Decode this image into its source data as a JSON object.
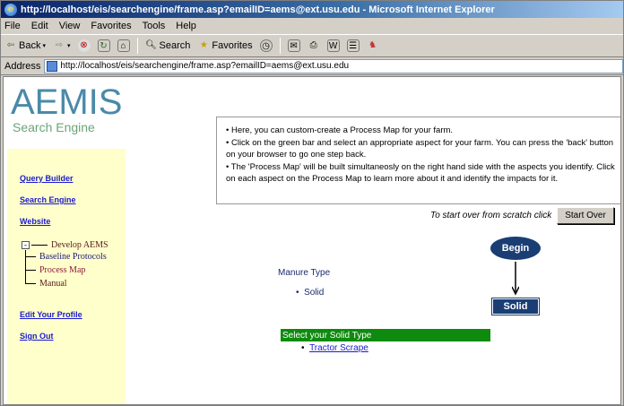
{
  "window": {
    "title": "http://localhost/eis/searchengine/frame.asp?emailID=aems@ext.usu.edu - Microsoft Internet Explorer"
  },
  "menubar": [
    "File",
    "Edit",
    "View",
    "Favorites",
    "Tools",
    "Help"
  ],
  "toolbar": {
    "back": "Back",
    "search": "Search",
    "favorites": "Favorites"
  },
  "address": {
    "label": "Address",
    "url": "http://localhost/eis/searchengine/frame.asp?emailID=aems@ext.usu.edu"
  },
  "sidebar": {
    "logo_main": "AEMIS",
    "logo_sub": "Search Engine",
    "links": {
      "query_builder": "Query Builder",
      "search_engine": "Search Engine",
      "website": "Website",
      "edit_profile": "Edit Your Profile",
      "sign_out": "Sign Out"
    },
    "tree": {
      "root": "Develop AEMS",
      "toggle": "-",
      "children": [
        "Baseline Protocols",
        "Process Map",
        "Manual"
      ]
    }
  },
  "instructions": [
    "Here, you can custom-create a Process Map for your farm.",
    "Click on the green bar and select an appropriate aspect for your farm. You can press the 'back' button on your browser to go one step back.",
    "The 'Process Map' will be built simultaneosly on the right hand side with the aspects you identify. Click on each aspect on the Process Map to learn more about it and identify the impacts for it."
  ],
  "start_over": {
    "prompt": "To start over from scratch click",
    "button": "Start Over"
  },
  "selection": {
    "category": "Manure Type",
    "value": "Solid",
    "next_prompt": "Select your Solid Type",
    "next_option": "Tractor Scrape"
  },
  "process_map": {
    "begin": "Begin",
    "node": "Solid"
  },
  "colors": {
    "green_bar": "#0e8a0e",
    "node_blue": "#1a3e74",
    "sidebar_bg": "#ffffcc",
    "link_blue": "#1a1acc"
  }
}
